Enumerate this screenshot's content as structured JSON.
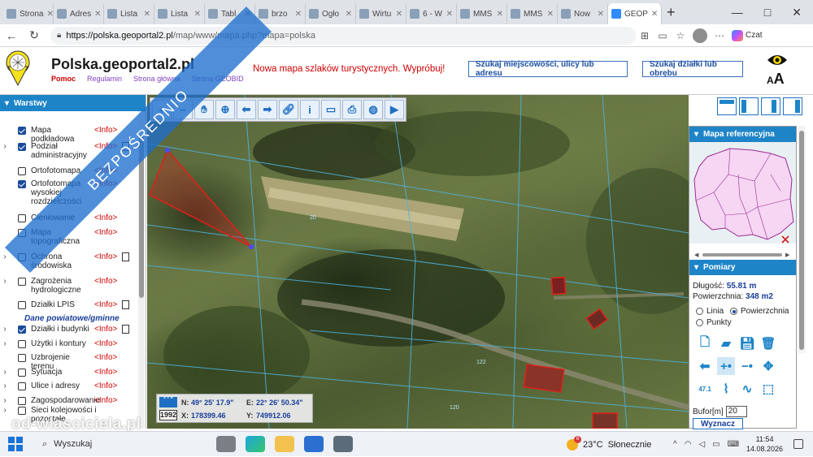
{
  "browser": {
    "tabs": [
      {
        "label": "Strona"
      },
      {
        "label": "Adres"
      },
      {
        "label": "Lista"
      },
      {
        "label": "Lista"
      },
      {
        "label": "Tabl"
      },
      {
        "label": "brzo"
      },
      {
        "label": "Ogło"
      },
      {
        "label": "Wirtu"
      },
      {
        "label": "6 - W"
      },
      {
        "label": "MMS"
      },
      {
        "label": "MMS"
      },
      {
        "label": "Now"
      },
      {
        "label": "GEOP",
        "active": true
      }
    ],
    "new_tab": "+",
    "window_controls": {
      "minimize": "—",
      "maximize": "□",
      "close": "✕"
    },
    "url_host": "https://polska.geoportal2.pl",
    "url_path": "/map/www/mapa.php?mapa=polska",
    "copilot_label": "Czat"
  },
  "site": {
    "title": "Polska.geoportal2.pl",
    "links": [
      "Pomoc",
      "Regulamin",
      "Strona główna",
      "Strona GEOBID"
    ],
    "promo": "Nowa mapa szlaków turystycznych. Wypróbuj!",
    "btn_search": "Szukaj miejscowości, ulicy lub adresu",
    "btn_parcel": "Szukaj działki lub obrębu",
    "font_size_label": "AA"
  },
  "layers_panel": {
    "title": "Warstwy",
    "info": "<Info>",
    "section_label": "Dane powiatowe/gminne",
    "items": [
      {
        "name": "Mapa podkładowa",
        "checked": true,
        "expand": false,
        "doc": false
      },
      {
        "name": "Podział administracyjny",
        "checked": true,
        "expand": true,
        "doc": true
      },
      {
        "name": "Ortofotomapa",
        "checked": false,
        "expand": false,
        "doc": false
      },
      {
        "name": "Ortofotomapa wysokiej rozdzielczości",
        "checked": true,
        "expand": false,
        "doc": false
      },
      {
        "name": "Cieniowanie",
        "checked": false,
        "expand": false,
        "doc": false
      },
      {
        "name": "Mapa topograficzna",
        "checked": false,
        "expand": false,
        "doc": false
      },
      {
        "name": "Ochrona środowiska",
        "checked": false,
        "expand": true,
        "doc": true
      },
      {
        "name": "Zagrożenia hydrologiczne",
        "checked": false,
        "expand": true,
        "doc": false
      },
      {
        "name": "Działki LPIS",
        "checked": false,
        "expand": false,
        "doc": true
      },
      {
        "name": "Działki i budynki",
        "checked": true,
        "expand": true,
        "doc": true
      },
      {
        "name": "Użytki i kontury",
        "checked": false,
        "expand": true,
        "doc": false
      },
      {
        "name": "Uzbrojenie terenu",
        "checked": false,
        "expand": false,
        "doc": false
      },
      {
        "name": "Sytuacja",
        "checked": false,
        "expand": true,
        "doc": false
      },
      {
        "name": "Ulice i adresy",
        "checked": false,
        "expand": true,
        "doc": false
      },
      {
        "name": "Zagospodarowanie",
        "checked": false,
        "expand": true,
        "doc": false
      }
    ],
    "bottom_item": "Sieci kolejowości i pozostałe"
  },
  "map": {
    "coords": {
      "n_label": "N:",
      "n_value": "49° 25' 17.9\"",
      "e_label": "E:",
      "e_value": "22° 26' 50.34\"",
      "x_label": "X:",
      "x_value": "178399.46",
      "y_label": "Y:",
      "y_value": "749912.06",
      "scale_year": "1992"
    },
    "parcel_labels": [
      "20",
      "122",
      "120",
      "20"
    ]
  },
  "right_panel": {
    "ref_title": "Mapa referencyjna",
    "measure_title": "Pomiary",
    "length_label": "Długość:",
    "length_value": "55.81 m",
    "area_label": "Powierzchnia:",
    "area_value": "348 m2",
    "radio_line": "Linia",
    "radio_area": "Powierzchnia",
    "radio_points": "Punkty",
    "selected_mode": "Powierzchnia",
    "buffer_label": "Bufor[m]",
    "buffer_value": "20",
    "calc_button": "Wyznacz",
    "tool_label": "47.1"
  },
  "watermark": {
    "ribbon": "BEZPOŚREDNIO",
    "text": "od-wlasciciela.pl"
  },
  "taskbar": {
    "search_placeholder": "Wyszukaj",
    "weather_temp": "23°C",
    "weather_desc": "Słonecznie",
    "weather_badge": "6",
    "time": "11:54",
    "date": "14.08.2026"
  },
  "colors": {
    "accent": "#1e84c8",
    "info_red": "#d00000",
    "parcel_outline": "#e0201a"
  }
}
